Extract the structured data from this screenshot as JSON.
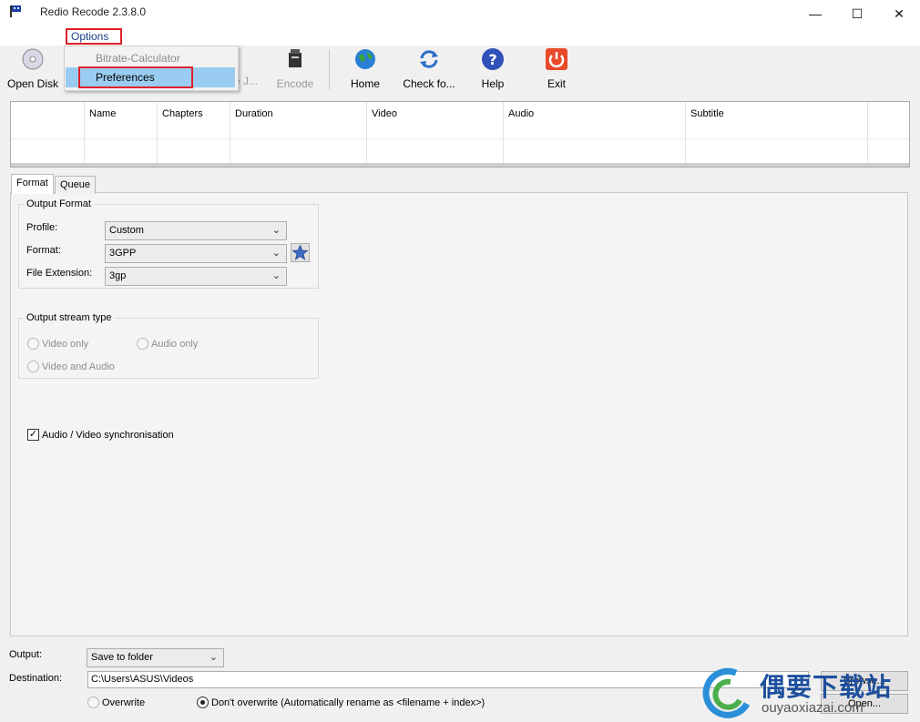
{
  "window": {
    "title": "Redio Recode 2.3.8.0",
    "minimize_glyph": "—",
    "maximize_glyph": "☐",
    "close_glyph": "✕"
  },
  "menubar": {
    "options_label": "Options"
  },
  "dropdown": {
    "items": [
      {
        "label": "Bitrate-Calculator"
      },
      {
        "label": "Preferences"
      }
    ]
  },
  "toolbar": {
    "open_disk": "Open Disk",
    "partial_label": "e J...",
    "encode": "Encode",
    "home": "Home",
    "check_for": "Check fo...",
    "help": "Help",
    "exit": "Exit",
    "icons": [
      "disc-icon",
      "encode-icon",
      "globe-icon",
      "refresh-icon",
      "help-icon",
      "power-icon"
    ]
  },
  "titles_table": {
    "columns": [
      "Name",
      "Chapters",
      "Duration",
      "Video",
      "Audio",
      "Subtitle"
    ]
  },
  "tabs": [
    {
      "label": "Format"
    },
    {
      "label": "Queue"
    }
  ],
  "output_format": {
    "title": "Output Format",
    "profile_label": "Profile:",
    "profile_value": "Custom",
    "format_label": "Format:",
    "format_value": "3GPP",
    "ext_label": "File Extension:",
    "ext_value": "3gp"
  },
  "stream_type": {
    "title": "Output stream type",
    "video_only": "Video only",
    "audio_only": "Audio only",
    "video_and_audio": "Video and Audio"
  },
  "sync": {
    "label": "Audio / Video synchronisation",
    "checked": true
  },
  "output": {
    "output_label": "Output:",
    "output_value": "Save to folder",
    "destination_label": "Destination:",
    "destination_value": "C:\\Users\\ASUS\\Videos",
    "browse_label": "Browse...",
    "open_label": "Open...",
    "overwrite_label": "Overwrite",
    "dont_overwrite_label": "Don't overwrite (Automatically rename as <filename + index>)"
  },
  "watermark": {
    "cn": "偶要下载站",
    "url": "ouyaoxiazai.com"
  },
  "colors": {
    "highlight_red": "#e0202a",
    "menu_highlight": "#99ccf0",
    "watermark_blue": "#1d4f9c"
  }
}
